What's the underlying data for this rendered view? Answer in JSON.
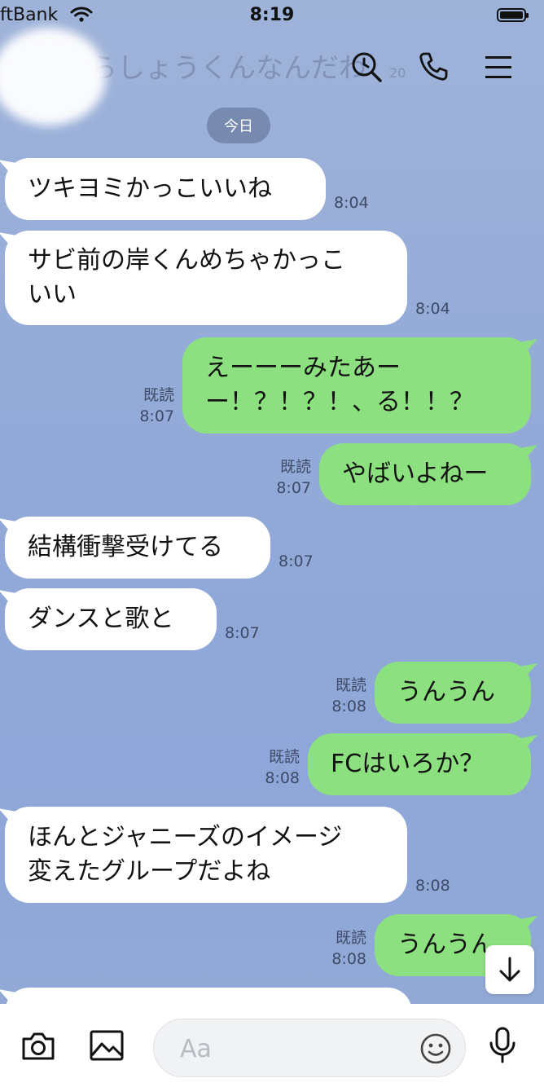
{
  "status_bar": {
    "carrier": "ftBank",
    "time": "8:19"
  },
  "header": {
    "contact_name": "らしょうくんなんだわ",
    "sub": "20"
  },
  "date_divider": "今日",
  "messages": [
    {
      "side": "in",
      "lines": [
        "ツキヨミかっこいいね"
      ],
      "time": "8:04",
      "read": ""
    },
    {
      "side": "in",
      "lines": [
        "サビ前の岸くんめちゃかっこ",
        "いい"
      ],
      "time": "8:04",
      "read": ""
    },
    {
      "side": "out",
      "lines": [
        "えーーーみたあー",
        "ー！？！？！、る！！？"
      ],
      "time": "8:07",
      "read": "既読"
    },
    {
      "side": "out",
      "lines": [
        "やばいよねー"
      ],
      "time": "8:07",
      "read": "既読"
    },
    {
      "side": "in",
      "lines": [
        "結構衝撃受けてる"
      ],
      "time": "8:07",
      "read": ""
    },
    {
      "side": "in",
      "lines": [
        "ダンスと歌と"
      ],
      "time": "8:07",
      "read": ""
    },
    {
      "side": "out",
      "lines": [
        "うんうん"
      ],
      "time": "8:08",
      "read": "既読"
    },
    {
      "side": "out",
      "lines": [
        "FCはいろか？"
      ],
      "time": "8:08",
      "read": "既読"
    },
    {
      "side": "in",
      "lines": [
        "ほんとジャニーズのイメージ",
        "変えたグループだよね"
      ],
      "time": "8:08",
      "read": ""
    },
    {
      "side": "out",
      "lines": [
        "うんうん"
      ],
      "time": "8:08",
      "read": "既読"
    },
    {
      "side": "in",
      "lines": [
        ""
      ],
      "time": "",
      "read": ""
    }
  ],
  "input": {
    "placeholder": "Aa"
  },
  "icons": {
    "header": [
      "search-icon",
      "phone-icon",
      "menu-icon"
    ],
    "toolbar": [
      "camera-icon",
      "image-icon",
      "emoji-icon",
      "microphone-icon"
    ],
    "scroll": "arrow-down-icon"
  },
  "colors": {
    "background": "#93aad8",
    "outgoing_bubble": "#8de07f",
    "incoming_bubble": "#ffffff"
  }
}
